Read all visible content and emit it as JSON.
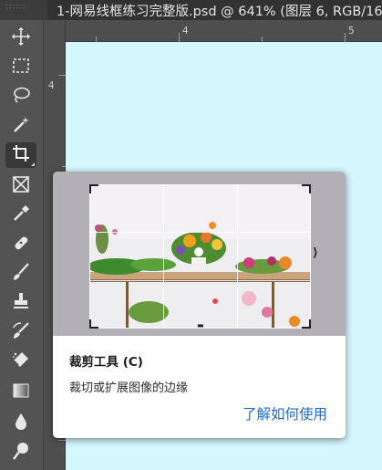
{
  "document_tab": {
    "grip_text": "::::::",
    "title": "1-网易线框练习完整版.psd @ 641% (图层 6, RGB/16"
  },
  "toolbar": {
    "tools": [
      {
        "name": "move-tool",
        "icon": "move-icon"
      },
      {
        "name": "rectangular-marquee-tool",
        "icon": "marquee-icon"
      },
      {
        "name": "lasso-tool",
        "icon": "lasso-icon"
      },
      {
        "name": "magic-wand-tool",
        "icon": "magic-wand-icon"
      },
      {
        "name": "crop-tool",
        "icon": "crop-icon",
        "active": true
      },
      {
        "name": "frame-tool",
        "icon": "frame-icon"
      },
      {
        "name": "eyedropper-tool",
        "icon": "eyedropper-icon"
      },
      {
        "name": "healing-brush-tool",
        "icon": "bandage-icon"
      },
      {
        "name": "brush-tool",
        "icon": "brush-icon"
      },
      {
        "name": "clone-stamp-tool",
        "icon": "stamp-icon"
      },
      {
        "name": "history-brush-tool",
        "icon": "history-brush-icon"
      },
      {
        "name": "eraser-tool",
        "icon": "eraser-icon"
      },
      {
        "name": "gradient-tool",
        "icon": "gradient-icon"
      },
      {
        "name": "blur-tool",
        "icon": "droplet-icon"
      },
      {
        "name": "dodge-tool",
        "icon": "dodge-icon"
      }
    ]
  },
  "rulers": {
    "top_labels": [
      "4",
      "5"
    ],
    "left_labels": [
      "4"
    ]
  },
  "tooltip": {
    "title": "裁剪工具 (C)",
    "description": "裁切或扩展图像的边缘",
    "link": "了解如何使用"
  },
  "colors": {
    "canvas": "#d4f6fd",
    "toolbar": "#535353",
    "link": "#1d6ccb"
  }
}
